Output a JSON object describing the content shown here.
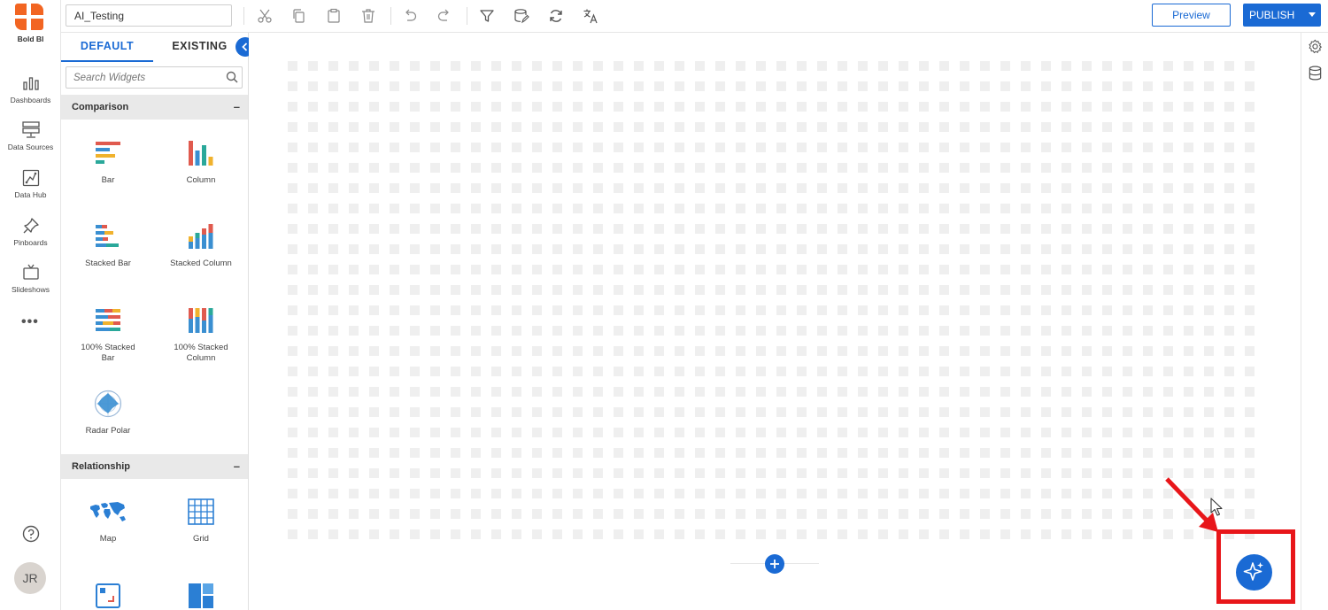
{
  "app": {
    "logo_text": "Bold BI"
  },
  "nav": {
    "items": [
      {
        "label": "Dashboards",
        "icon": "dashboards-icon"
      },
      {
        "label": "Data Sources",
        "icon": "data-sources-icon"
      },
      {
        "label": "Data Hub",
        "icon": "data-hub-icon"
      },
      {
        "label": "Pinboards",
        "icon": "pinboards-icon"
      },
      {
        "label": "Slideshows",
        "icon": "slideshows-icon"
      }
    ],
    "more": "•••",
    "avatar_initials": "JR"
  },
  "toolbar": {
    "dashboard_name": "AI_Testing",
    "icons": [
      "cut-icon",
      "copy-icon",
      "paste-icon",
      "delete-icon",
      "undo-icon",
      "redo-icon",
      "filter-icon",
      "data-source-edit-icon",
      "refresh-icon",
      "translate-icon"
    ],
    "preview_label": "Preview",
    "publish_label": "PUBLISH"
  },
  "panel": {
    "tabs": [
      "DEFAULT",
      "EXISTING"
    ],
    "active_tab": "DEFAULT",
    "search_placeholder": "Search Widgets",
    "sections": [
      {
        "title": "Comparison",
        "collapse": "–",
        "widgets": [
          "Bar",
          "Column",
          "Stacked Bar",
          "Stacked Column",
          "100% Stacked Bar",
          "100% Stacked Column",
          "Radar Polar"
        ]
      },
      {
        "title": "Relationship",
        "collapse": "–",
        "widgets": [
          "Map",
          "Grid"
        ]
      }
    ]
  },
  "colors": {
    "accent": "#1a6ad4",
    "highlight": "#e8161a",
    "logo": "#f26522"
  }
}
